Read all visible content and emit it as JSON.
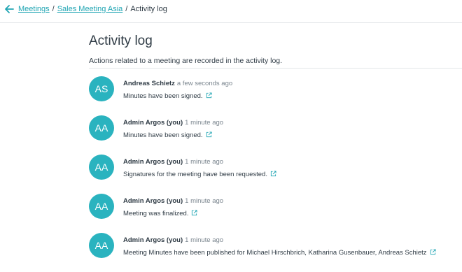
{
  "breadcrumb": {
    "items": [
      {
        "label": "Meetings"
      },
      {
        "label": "Sales Meeting Asia"
      }
    ],
    "separator": "/",
    "current": "Activity log"
  },
  "page": {
    "title": "Activity log",
    "description": "Actions related to a meeting are recorded in the activity log."
  },
  "activities": [
    {
      "initials": "AS",
      "author": "Andreas Schietz",
      "time": "a few seconds ago",
      "message": "Minutes have been signed."
    },
    {
      "initials": "AA",
      "author": "Admin Argos (you)",
      "time": "1 minute ago",
      "message": "Minutes have been signed."
    },
    {
      "initials": "AA",
      "author": "Admin Argos (you)",
      "time": "1 minute ago",
      "message": "Signatures for the meeting have been requested."
    },
    {
      "initials": "AA",
      "author": "Admin Argos (you)",
      "time": "1 minute ago",
      "message": "Meeting was finalized."
    },
    {
      "initials": "AA",
      "author": "Admin Argos (you)",
      "time": "1 minute ago",
      "message": "Meeting Minutes have been published for Michael Hirschbrich, Katharina Gusenbauer, Andreas Schietz"
    }
  ],
  "icons": {
    "back": "arrow-left-icon",
    "entry_link": "external-link-icon"
  },
  "colors": {
    "accent": "#20a5b3",
    "avatar_bg": "#2ab3bf",
    "text": "#2f3b45",
    "muted": "#7a858e",
    "divider": "#e3e6e9"
  }
}
